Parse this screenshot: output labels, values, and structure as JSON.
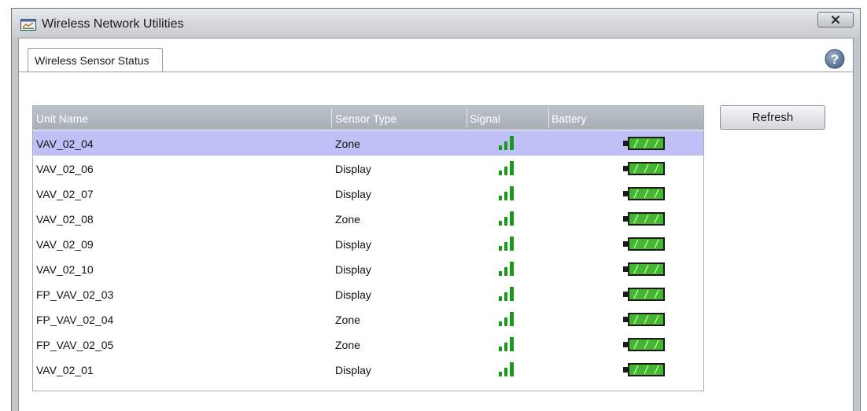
{
  "window": {
    "title": "Wireless Network Utilities",
    "icon": "app-window-icon",
    "close_icon": "close-icon"
  },
  "tabs": [
    {
      "label": "Wireless Sensor Status",
      "active": true
    }
  ],
  "help_icon": "help-icon",
  "list": {
    "columns": {
      "unit_name": "Unit Name",
      "sensor_type": "Sensor Type",
      "signal": "Signal",
      "battery": "Battery"
    },
    "selected_index": 0,
    "rows": [
      {
        "unit_name": "VAV_02_04",
        "sensor_type": "Zone",
        "signal": "signal-strength-icon",
        "battery": "battery-full-icon"
      },
      {
        "unit_name": "VAV_02_06",
        "sensor_type": "Display",
        "signal": "signal-strength-icon",
        "battery": "battery-full-icon"
      },
      {
        "unit_name": "VAV_02_07",
        "sensor_type": "Display",
        "signal": "signal-strength-icon",
        "battery": "battery-full-icon"
      },
      {
        "unit_name": "VAV_02_08",
        "sensor_type": "Zone",
        "signal": "signal-strength-icon",
        "battery": "battery-full-icon"
      },
      {
        "unit_name": "VAV_02_09",
        "sensor_type": "Display",
        "signal": "signal-strength-icon",
        "battery": "battery-full-icon"
      },
      {
        "unit_name": "VAV_02_10",
        "sensor_type": "Display",
        "signal": "signal-strength-icon",
        "battery": "battery-full-icon"
      },
      {
        "unit_name": "FP_VAV_02_03",
        "sensor_type": "Display",
        "signal": "signal-strength-icon",
        "battery": "battery-full-icon"
      },
      {
        "unit_name": "FP_VAV_02_04",
        "sensor_type": "Zone",
        "signal": "signal-strength-icon",
        "battery": "battery-full-icon"
      },
      {
        "unit_name": "FP_VAV_02_05",
        "sensor_type": "Zone",
        "signal": "signal-strength-icon",
        "battery": "battery-full-icon"
      },
      {
        "unit_name": "VAV_02_01",
        "sensor_type": "Display",
        "signal": "signal-strength-icon",
        "battery": "battery-full-icon"
      }
    ]
  },
  "refresh_button": {
    "label": "Refresh"
  },
  "colors": {
    "selection": "#bfc0f6",
    "signal": "#1a9a1a",
    "battery": "#45b72e"
  }
}
